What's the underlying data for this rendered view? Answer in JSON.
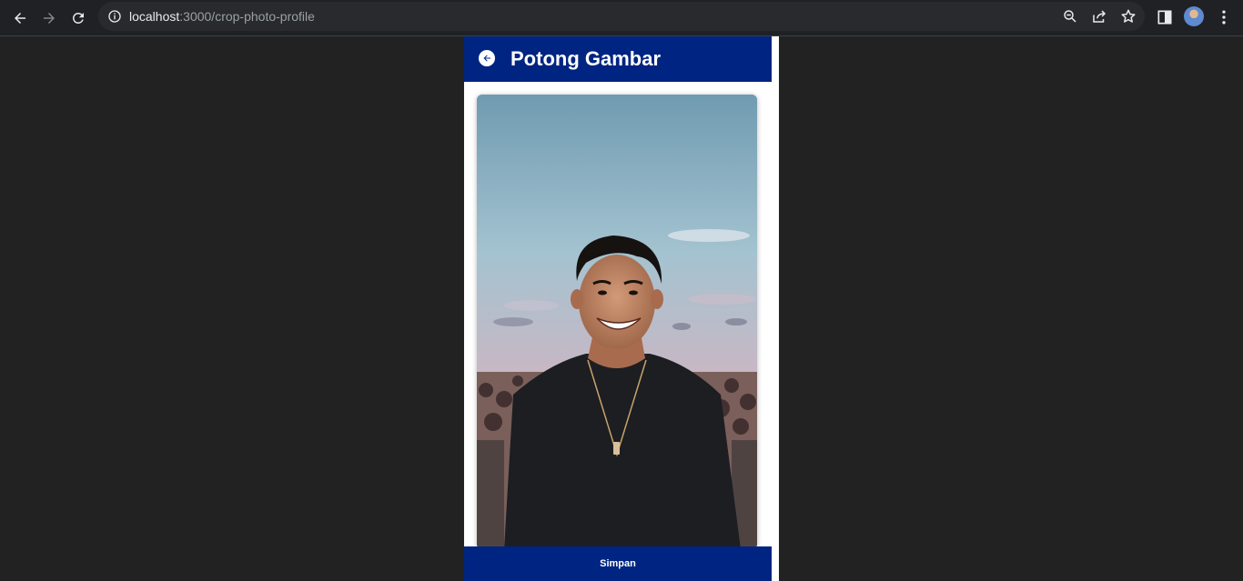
{
  "browser": {
    "url_host": "localhost",
    "url_path": ":3000/crop-photo-profile"
  },
  "header": {
    "title": "Potong Gambar"
  },
  "footer": {
    "save_label": "Simpan"
  },
  "colors": {
    "brand": "#002481",
    "page_background": "#222222"
  }
}
